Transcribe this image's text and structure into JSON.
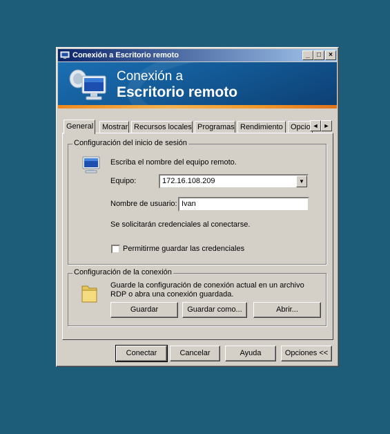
{
  "window": {
    "title": "Conexión a Escritorio remoto",
    "controls": {
      "minimize": "_",
      "maximize": "□",
      "close": "×"
    }
  },
  "banner": {
    "line1": "Conexión a",
    "line2": "Escritorio remoto"
  },
  "tabs": [
    {
      "label": "General",
      "active": true
    },
    {
      "label": "Mostrar"
    },
    {
      "label": "Recursos locales"
    },
    {
      "label": "Programas"
    },
    {
      "label": "Rendimiento"
    },
    {
      "label": "Opcio"
    }
  ],
  "tab_scroll": {
    "left": "◄",
    "right": "►"
  },
  "login_group": {
    "legend": "Configuración del inicio de sesión",
    "instruction": "Escriba el nombre del equipo remoto.",
    "computer_label": "Equipo:",
    "computer_value": "172.16.108.209",
    "combo_arrow": "▼",
    "username_label": "Nombre de usuario:",
    "username_value": "Ivan",
    "credentials_note": "Se solicitarán credenciales al conectarse.",
    "save_credentials_label": "Permitirme guardar las credenciales",
    "save_credentials_checked": false
  },
  "connection_group": {
    "legend": "Configuración de la conexión",
    "description_line1": "Guarde la configuración de conexión actual en un archivo",
    "description_line2": "RDP o abra una conexión guardada.",
    "save_label": "Guardar",
    "save_as_label": "Guardar como...",
    "open_label": "Abrir..."
  },
  "footer": {
    "connect_label": "Conectar",
    "cancel_label": "Cancelar",
    "help_label": "Ayuda",
    "options_label": "Opciones <<"
  }
}
